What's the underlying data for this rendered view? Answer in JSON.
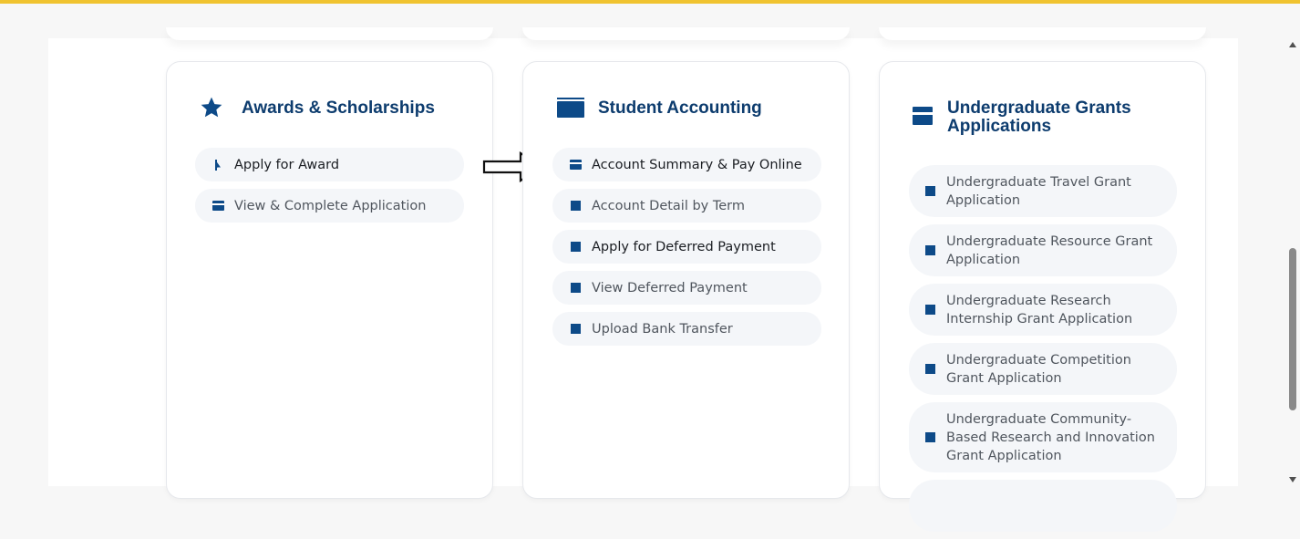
{
  "cards": {
    "awards": {
      "title": "Awards & Scholarships",
      "items": [
        {
          "label": "Apply for Award",
          "icon": "cursor-icon"
        },
        {
          "label": "View & Complete Application",
          "icon": "credit-card-icon"
        }
      ]
    },
    "accounting": {
      "title": "Student Accounting",
      "items": [
        {
          "label": "Account Summary & Pay Online",
          "icon": "credit-card-icon"
        },
        {
          "label": "Account Detail by Term",
          "icon": "square-icon"
        },
        {
          "label": "Apply for Deferred Payment",
          "icon": "square-icon"
        },
        {
          "label": "View Deferred Payment",
          "icon": "square-icon"
        },
        {
          "label": "Upload Bank Transfer",
          "icon": "square-icon"
        }
      ]
    },
    "grants": {
      "title": "Undergraduate Grants Applications",
      "items": [
        {
          "label": "Undergraduate Travel Grant Application",
          "icon": "square-icon"
        },
        {
          "label": "Undergraduate Resource Grant Application",
          "icon": "square-icon"
        },
        {
          "label": "Undergraduate Research Internship Grant Application",
          "icon": "square-icon"
        },
        {
          "label": "Undergraduate Competition Grant Application",
          "icon": "square-icon"
        },
        {
          "label": "Undergraduate Community-Based Research and Innovation Grant Application",
          "icon": "square-icon"
        }
      ]
    }
  },
  "colors": {
    "accent_bar": "#f0c330",
    "brand_navy": "#0d3c6e",
    "icon_blue": "#0d4a88",
    "pill_bg": "#f4f6f9"
  }
}
